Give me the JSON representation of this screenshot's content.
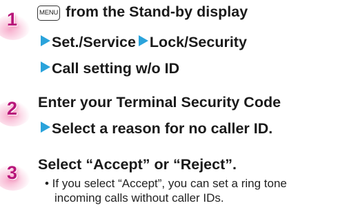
{
  "steps": [
    {
      "number": "1",
      "key_label": "MENU",
      "line1": "from the Stand-by display",
      "line2_a": "Set./Service",
      "line2_b": "Lock/Security",
      "line3": "Call setting w/o ID"
    },
    {
      "number": "2",
      "line1": "Enter your Terminal Security Code",
      "line2": "Select a reason for no caller ID."
    },
    {
      "number": "3",
      "line1": "Select “Accept” or “Reject”.",
      "note_line1": "• If you select “Accept”, you can set a ring tone",
      "note_line2": "incoming calls without caller IDs."
    }
  ],
  "colors": {
    "step_number": "#b8167a",
    "arrow": "#2aa3db",
    "text": "#1a1a1a"
  }
}
